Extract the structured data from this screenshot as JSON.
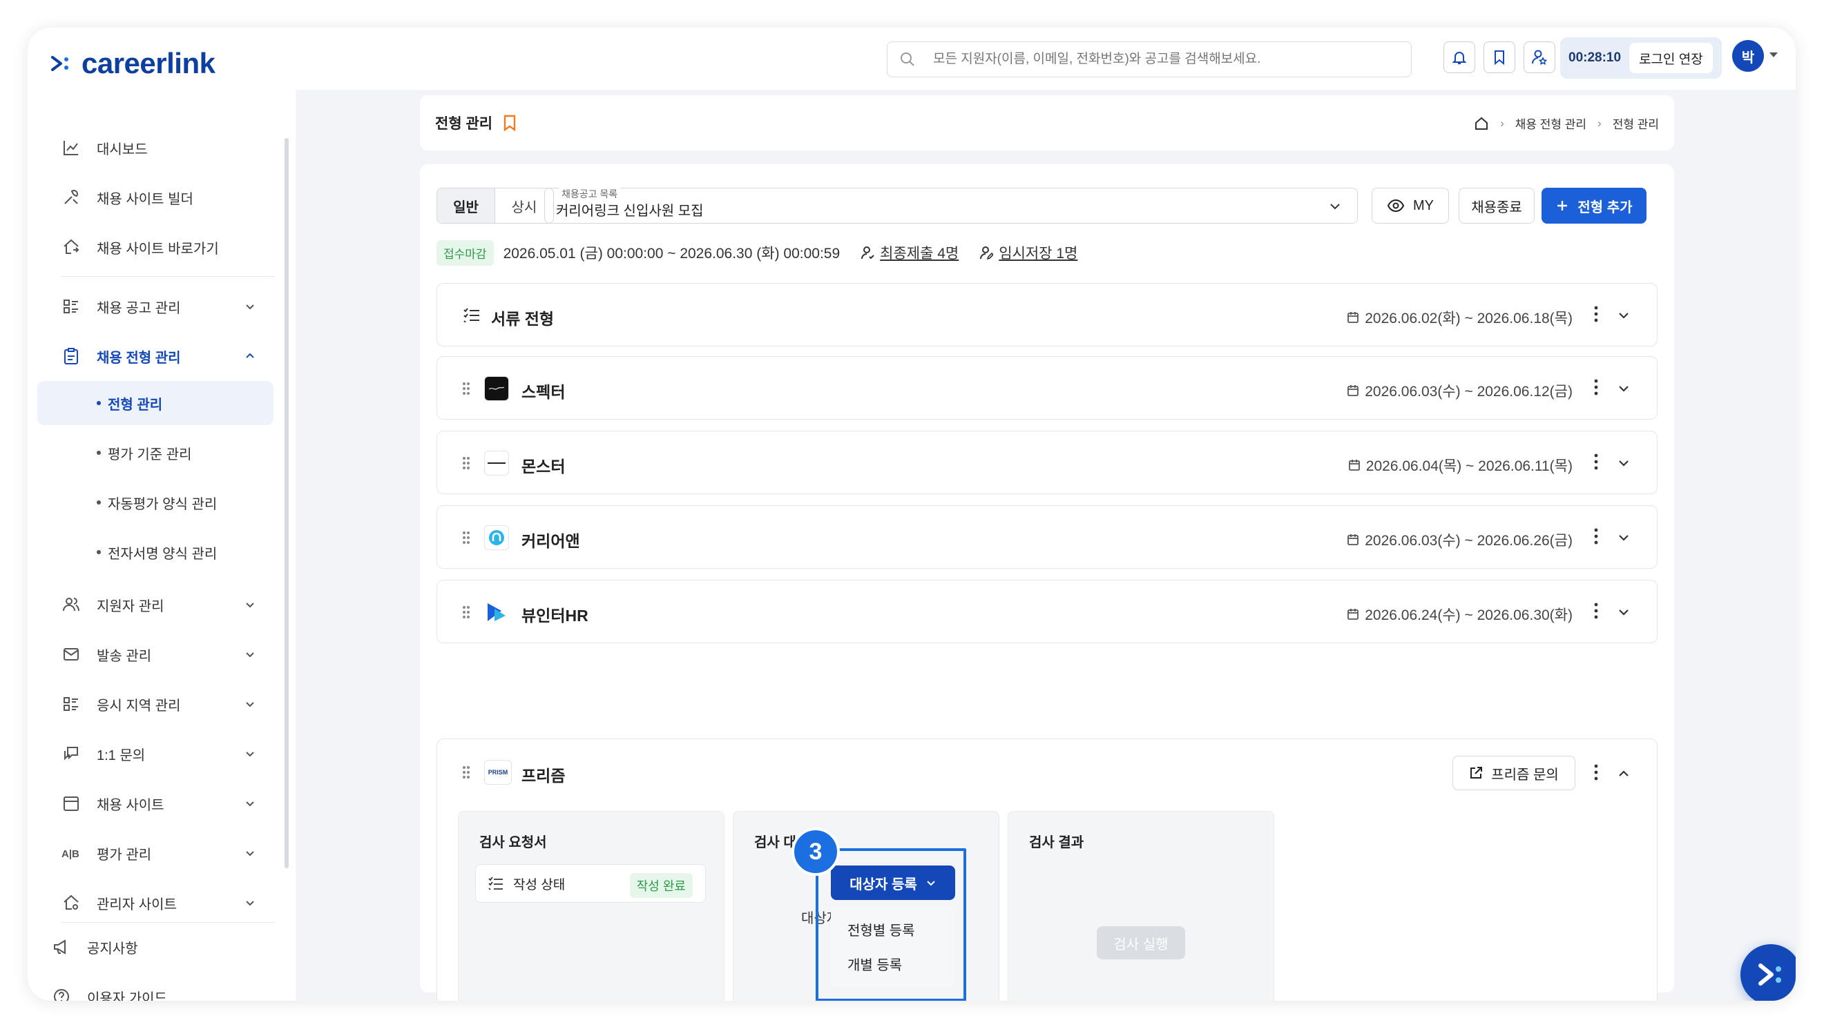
{
  "header": {
    "logo_text": "careerlink",
    "search_placeholder": "모든 지원자(이름, 이메일, 전화번호)와 공고를 검색해보세요.",
    "timer": "00:28:10",
    "extend_label": "로그인 연장",
    "avatar_initial": "박"
  },
  "sidebar": {
    "items": [
      {
        "label": "대시보드",
        "icon": "chart-icon"
      },
      {
        "label": "채용 사이트 빌더",
        "icon": "tools-icon"
      },
      {
        "label": "채용 사이트 바로가기",
        "icon": "home-link-icon"
      },
      {
        "label": "채용 공고 관리",
        "icon": "list-icon"
      },
      {
        "label": "채용 전형 관리",
        "icon": "clipboard-icon"
      },
      {
        "label": "지원자 관리",
        "icon": "users-icon"
      },
      {
        "label": "발송 관리",
        "icon": "mail-icon"
      },
      {
        "label": "응시 지역 관리",
        "icon": "list-icon"
      },
      {
        "label": "1:1 문의",
        "icon": "chat-icon"
      },
      {
        "label": "채용 사이트",
        "icon": "calendar-icon"
      },
      {
        "label": "평가 관리",
        "icon": "ab-icon"
      },
      {
        "label": "관리자 사이트",
        "icon": "home-gear-icon"
      },
      {
        "label": "공지사항",
        "icon": "megaphone-icon"
      },
      {
        "label": "이용자 가이드",
        "icon": "help-icon"
      }
    ],
    "sub_items": [
      "전형 관리",
      "평가 기준 관리",
      "자동평가 양식 관리",
      "전자서명 양식 관리"
    ]
  },
  "page": {
    "title": "전형 관리",
    "breadcrumbs": [
      "채용 전형 관리",
      "전형 관리"
    ]
  },
  "toolbar": {
    "tab_general": "일반",
    "tab_always": "상시",
    "posting_label": "채용공고 목록",
    "posting_value": "커리어링크 신입사원 모집",
    "my_label": "MY",
    "close_label": "채용종료",
    "add_label": "전형 추가"
  },
  "info": {
    "status_badge": "접수마감",
    "period": "2026.05.01 (금) 00:00:00 ~ 2026.06.30 (화) 00:00:59",
    "final_submit": "최종제출 4명",
    "temp_save": "임시저장 1명"
  },
  "stages": [
    {
      "name": "서류 전형",
      "dates": "2026.06.02(화) ~ 2026.06.18(목)"
    },
    {
      "name": "스펙터",
      "dates": "2026.06.03(수) ~ 2026.06.12(금)"
    },
    {
      "name": "몬스터",
      "dates": "2026.06.04(목) ~ 2026.06.11(목)"
    },
    {
      "name": "커리어앤",
      "dates": "2026.06.03(수) ~ 2026.06.26(금)"
    },
    {
      "name": "뷰인터HR",
      "dates": "2026.06.24(수) ~ 2026.06.30(화)"
    }
  ],
  "prism": {
    "name": "프리즘",
    "logo_text": "PRISM",
    "inquiry_label": "프리즘 문의",
    "cards": {
      "request_title": "검사 요청서",
      "status_label": "작성 상태",
      "status_value": "작성 완료",
      "target_title": "검사 대상",
      "target_empty": "대상자를 등록해 주세요.",
      "result_title": "검사 결과",
      "run_label": "검사 실행"
    },
    "register_button": "대상자 등록",
    "register_menu": [
      "전형별 등록",
      "개별 등록"
    ]
  },
  "annotation": {
    "step": "3"
  },
  "colors": {
    "brand": "#1448b8",
    "primary": "#1b5fd9",
    "highlight": "#1b6fe0",
    "success": "#2d9a4a",
    "bookmark": "#f07b1e"
  }
}
